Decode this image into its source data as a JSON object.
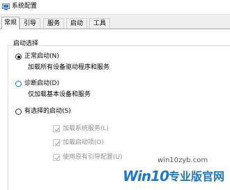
{
  "window": {
    "title": "系统配置",
    "icon": "system-config-icon"
  },
  "tabs": [
    {
      "label": "常规",
      "active": true
    },
    {
      "label": "引导",
      "active": false
    },
    {
      "label": "服务",
      "active": false
    },
    {
      "label": "启动",
      "active": false
    },
    {
      "label": "工具",
      "active": false
    }
  ],
  "startup_selection": {
    "legend": "启动选择",
    "options": [
      {
        "label": "正常启动(N)",
        "description": "加载所有设备驱动程序和服务",
        "checked": true
      },
      {
        "label": "诊断启动(D)",
        "description": "仅加载基本设备和服务",
        "checked": false
      },
      {
        "label": "有选择的启动(S)",
        "checked": false
      }
    ],
    "sub_options": [
      {
        "label": "加载系统服务(L)",
        "checked": true,
        "enabled": false
      },
      {
        "label": "加载启动项(O)",
        "checked": true,
        "enabled": false
      },
      {
        "label": "使用原有引导配置(U)",
        "checked": true,
        "enabled": false
      }
    ]
  },
  "watermark": {
    "url": "win10zyb.com",
    "brand": "Win10",
    "site_name": "专业版官网"
  },
  "colors": {
    "brand_blue": "#1f78c8",
    "disabled_text": "#8d8d8d",
    "focus_ring": "#0078d7"
  }
}
